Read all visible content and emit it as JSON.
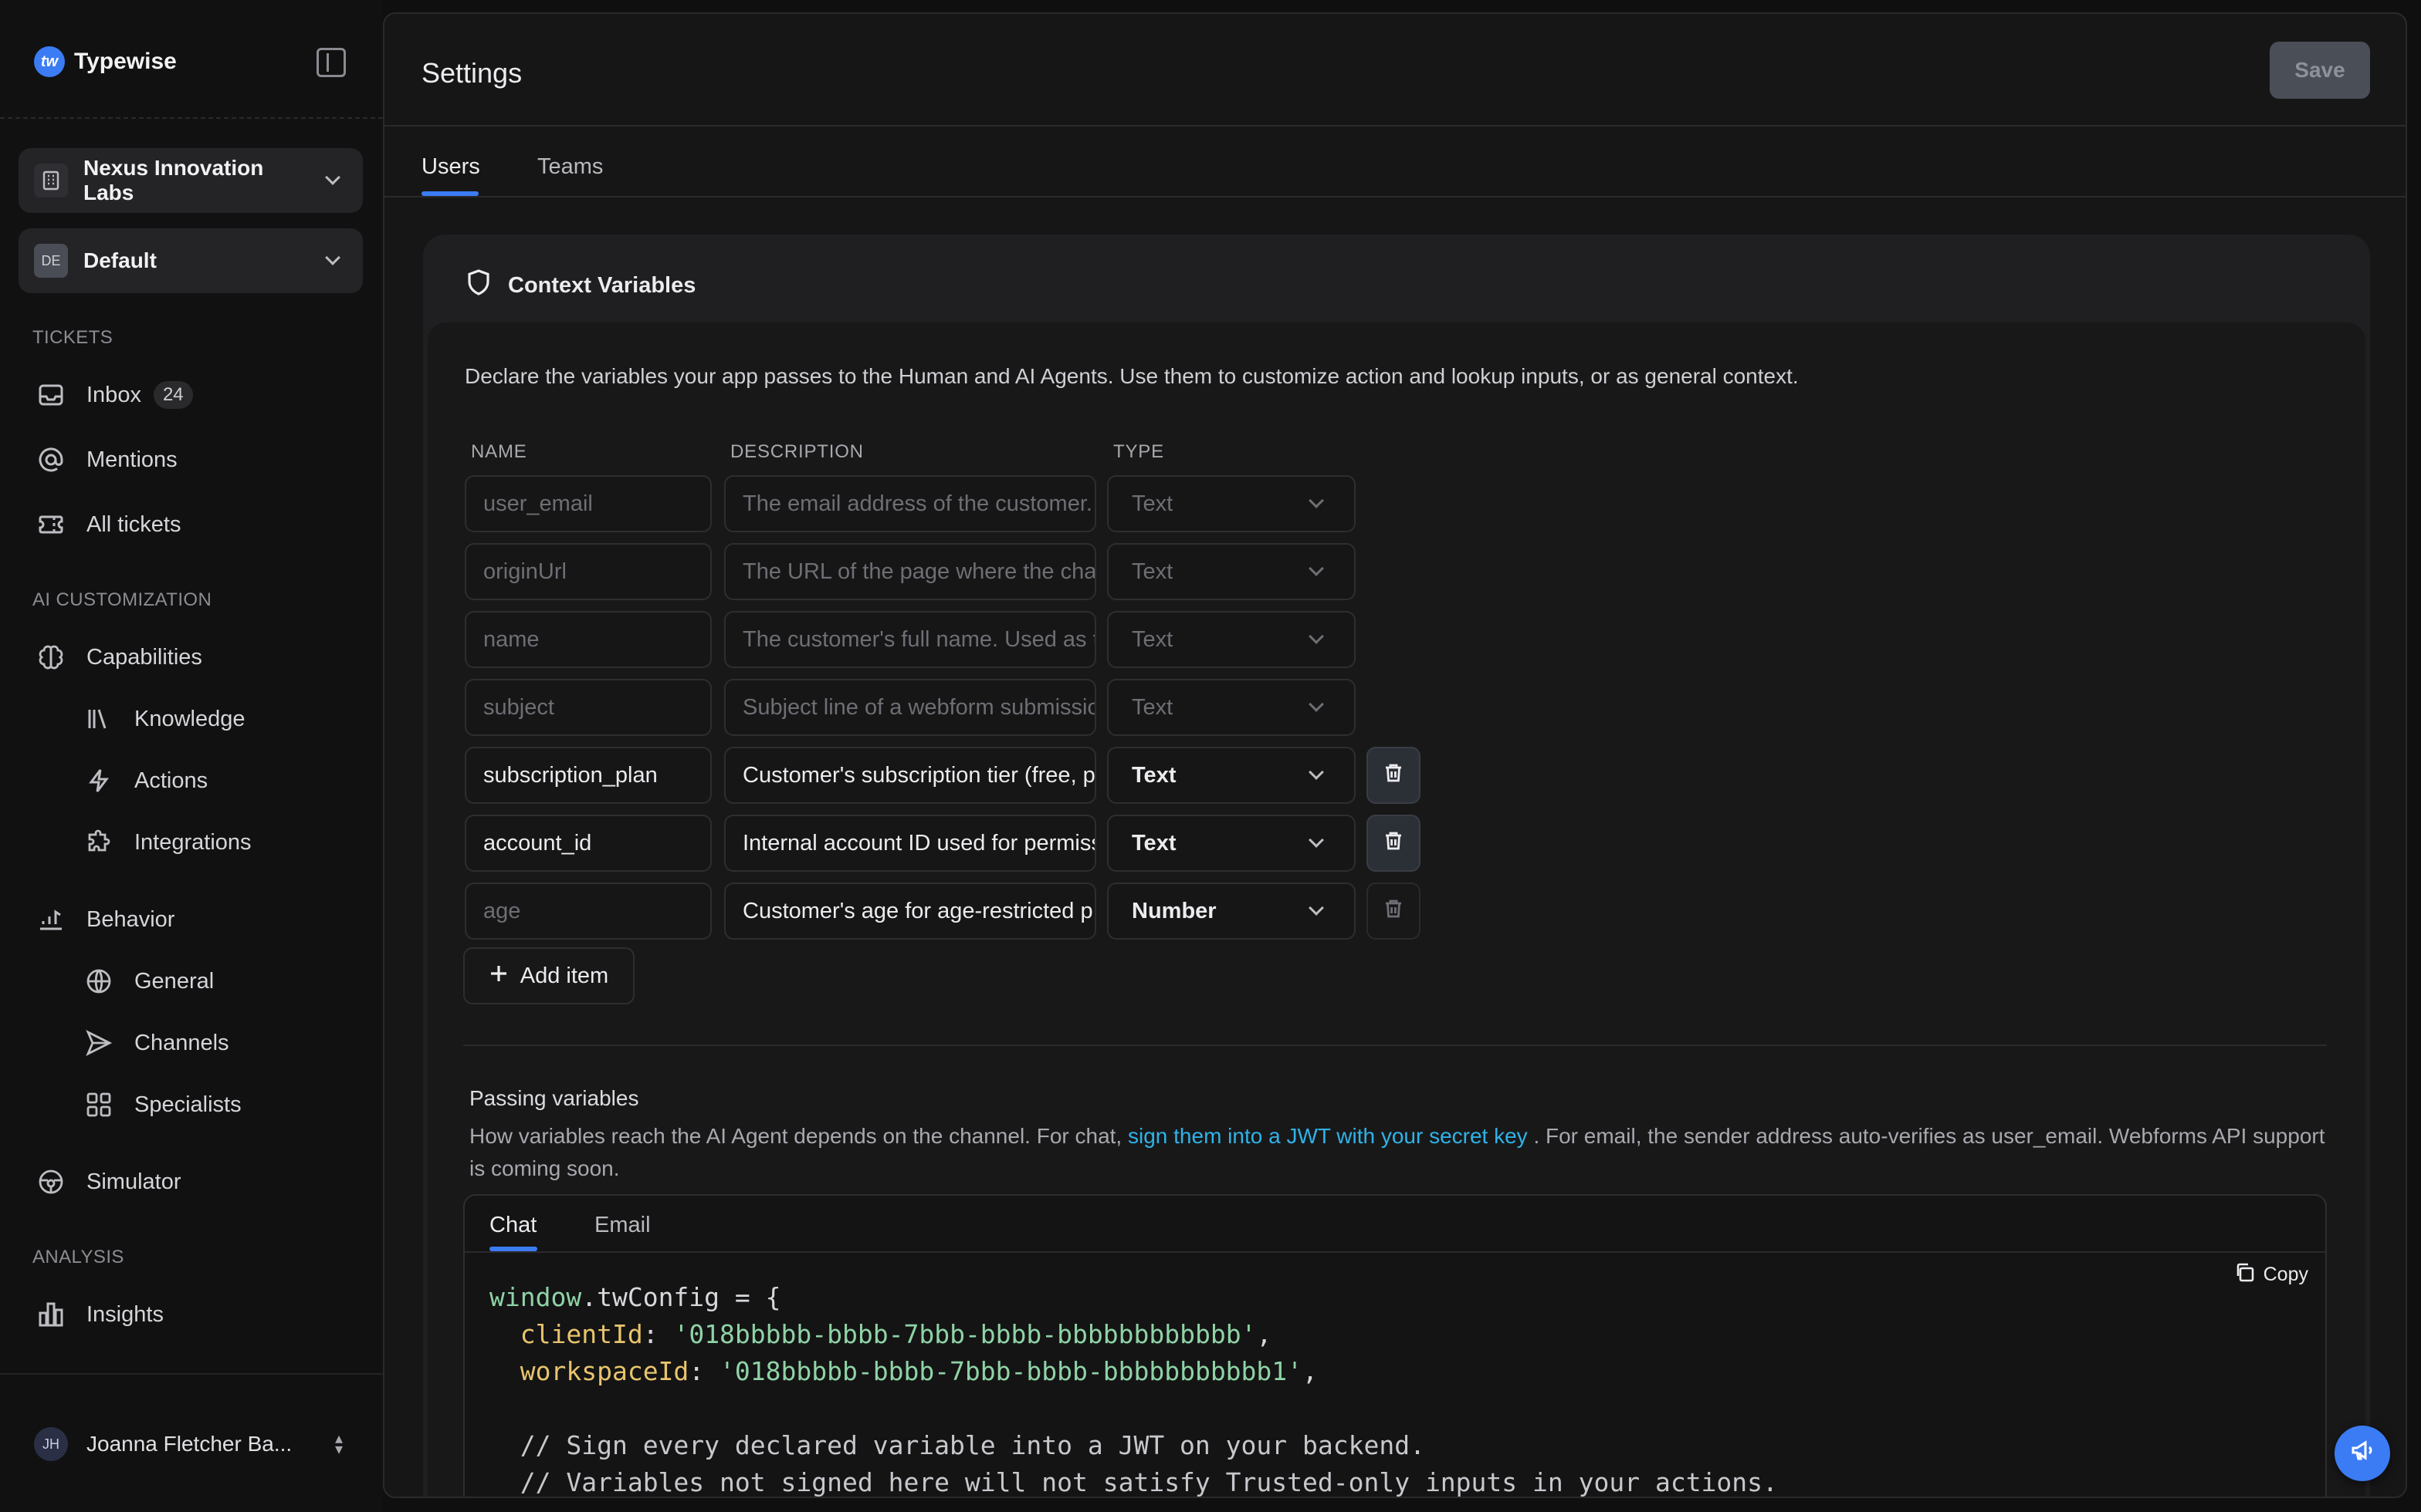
{
  "brand": {
    "name": "Typewise",
    "logo_text": "tw"
  },
  "sidebar": {
    "workspace": {
      "label": "Nexus Innovation Labs"
    },
    "environment": {
      "badge": "DE",
      "label": "Default"
    },
    "sections": {
      "tickets": "TICKETS",
      "ai_customization": "AI CUSTOMIZATION",
      "analysis": "ANALYSIS"
    },
    "items": {
      "inbox": {
        "label": "Inbox",
        "count": "24"
      },
      "mentions": {
        "label": "Mentions"
      },
      "all_tickets": {
        "label": "All tickets"
      },
      "capabilities": {
        "label": "Capabilities"
      },
      "knowledge": {
        "label": "Knowledge"
      },
      "actions": {
        "label": "Actions"
      },
      "integrations": {
        "label": "Integrations"
      },
      "behavior": {
        "label": "Behavior"
      },
      "general": {
        "label": "General"
      },
      "channels": {
        "label": "Channels"
      },
      "specialists": {
        "label": "Specialists"
      },
      "simulator": {
        "label": "Simulator"
      },
      "insights": {
        "label": "Insights"
      }
    },
    "user": {
      "initials": "JH",
      "name": "Joanna Fletcher Ba..."
    }
  },
  "header": {
    "title": "Settings",
    "save_label": "Save"
  },
  "tabs": {
    "users": "Users",
    "teams": "Teams"
  },
  "context_variables": {
    "title": "Context Variables",
    "description": "Declare the variables your app passes to the Human and AI Agents. Use them to customize action and lookup inputs, or as general context.",
    "columns": {
      "name": "NAME",
      "description": "DESCRIPTION",
      "type": "TYPE"
    },
    "rows": [
      {
        "name": "user_email",
        "description": "The email address of the customer.",
        "type": "Text"
      },
      {
        "name": "originUrl",
        "description": "The URL of the page where the chat",
        "type": "Text"
      },
      {
        "name": "name",
        "description": "The customer's full name. Used as th",
        "type": "Text"
      },
      {
        "name": "subject",
        "description": "Subject line of a webform submissio",
        "type": "Text"
      },
      {
        "name": "subscription_plan",
        "description": "Customer's subscription tier (free, p",
        "type": "Text"
      },
      {
        "name": "account_id",
        "description": "Internal account ID used for permiss",
        "type": "Text"
      },
      {
        "name": "age",
        "description": "Customer's age for age-restricted p",
        "type": "Number"
      }
    ],
    "add_item_label": "Add item"
  },
  "passing_variables": {
    "title": "Passing variables",
    "text_before": "How variables reach the AI Agent depends on the channel. For chat, ",
    "link": "sign them into a JWT with your secret key",
    "text_after": " . For email, the sender address auto-verifies as user_email. Webforms API support is coming soon.",
    "tabs": {
      "chat": "Chat",
      "email": "Email"
    },
    "copy_label": "Copy",
    "code": {
      "obj": "window",
      "prop": "twConfig",
      "open": " = {",
      "client_key": "clientId",
      "client_val": "'018bbbbb-bbbb-7bbb-bbbb-bbbbbbbbbbbb'",
      "workspace_key": "workspaceId",
      "workspace_val": "'018bbbbb-bbbb-7bbb-bbbb-bbbbbbbbbbb1'",
      "comment1": "// Sign every declared variable into a JWT on your backend.",
      "comment2": "// Variables not signed here will not satisfy Trusted-only inputs in your actions."
    }
  },
  "colors": {
    "accent": "#3b7cf5",
    "link": "#2fb3e8",
    "code_string": "#8fd3a6",
    "code_prop": "#e8c46c"
  }
}
